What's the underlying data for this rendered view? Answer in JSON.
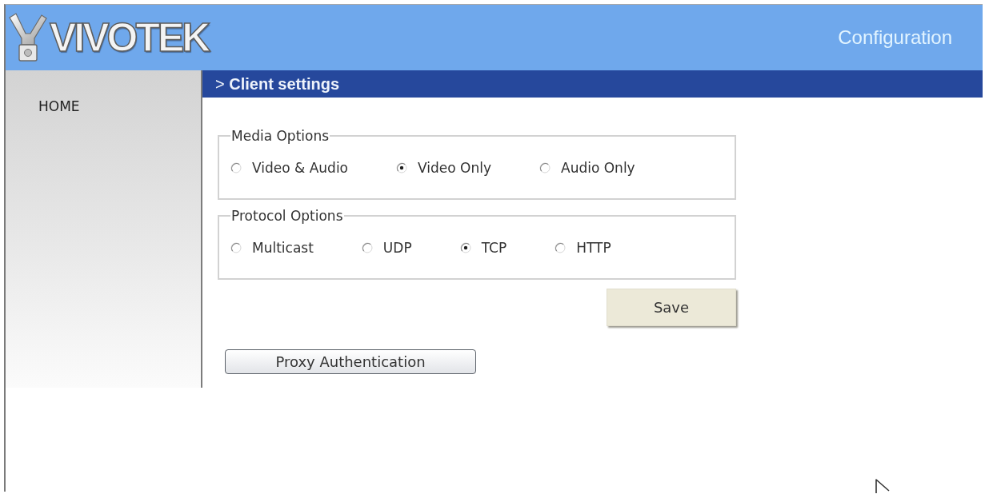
{
  "header": {
    "logo": "VIVOTEK",
    "title": "Configuration"
  },
  "sidebar": {
    "items": [
      {
        "label": "HOME"
      }
    ]
  },
  "section_title": "> **Client settings**",
  "groups": [
    {
      "legend": "Media Options",
      "options": [
        {
          "label": "Video & Audio",
          "selected": false
        },
        {
          "label": "Video Only",
          "selected": true
        },
        {
          "label": "Audio Only",
          "selected": false
        }
      ]
    },
    {
      "legend": "Protocol Options",
      "options": [
        {
          "label": "Multicast",
          "selected": false
        },
        {
          "label": "UDP",
          "selected": false
        },
        {
          "label": "TCP",
          "selected": true
        },
        {
          "label": "HTTP",
          "selected": false
        }
      ]
    }
  ],
  "save_button": {
    "label": "Save"
  },
  "proxy_button": {
    "label": "Proxy Authentication"
  }
}
